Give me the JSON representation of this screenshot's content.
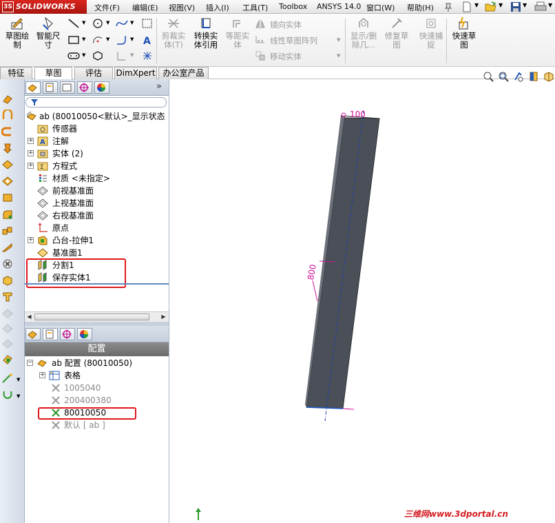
{
  "app": {
    "brand": "SOLIDWORKS",
    "ds_mark": "3S"
  },
  "menu": [
    "文件(F)",
    "编辑(E)",
    "视图(V)",
    "插入(I)",
    "工具(T)",
    "Toolbox",
    "ANSYS 14.0",
    "窗口(W)",
    "帮助(H)"
  ],
  "toolbar": {
    "sketch_line1": "草图绘",
    "sketch_line2": "制",
    "smartdim_line1": "智能尺",
    "smartdim_line2": "寸",
    "trim_line1": "剪裁实",
    "trim_line2": "体(T)",
    "convert_line1": "转换实",
    "convert_line2": "体引用",
    "offset_line1": "等距实",
    "offset_line2": "体",
    "mirror": "镜向实体",
    "linear_pattern": "线性草图阵列",
    "move": "移动实体",
    "show_delete_line1": "显示/删",
    "show_delete_line2": "除几...",
    "repair_line1": "修复草",
    "repair_line2": "图",
    "quick_snap_line1": "快速捕",
    "quick_snap_line2": "捉",
    "rapid_line1": "快速草",
    "rapid_line2": "图"
  },
  "tabs": [
    "特征",
    "草图",
    "评估",
    "DimXpert",
    "办公室产品"
  ],
  "feature_tree": {
    "root": "ab  (80010050<默认>_显示状态 1",
    "items": [
      "传感器",
      "注解",
      "实体 (2)",
      "方程式",
      "材质 <未指定>",
      "前视基准面",
      "上视基准面",
      "右视基准面",
      "原点",
      "凸台-拉伸1",
      "基准面1",
      "分割1",
      "保存实体1"
    ]
  },
  "config_manager": {
    "header": "配置",
    "root": "ab 配置  (80010050)",
    "table": "表格",
    "configs": [
      "1005040",
      "200400380",
      "80010050",
      "默认 [ ab ]"
    ]
  },
  "graphics": {
    "dim_top": "100",
    "dim_length": "800"
  },
  "watermark": "三维网www.3dportal.cn",
  "colors": {
    "brand_red": "#c01b14",
    "highlight_red": "#e0161b",
    "part_gray": "#4b5058",
    "dimension_magenta": "#d0109a"
  }
}
